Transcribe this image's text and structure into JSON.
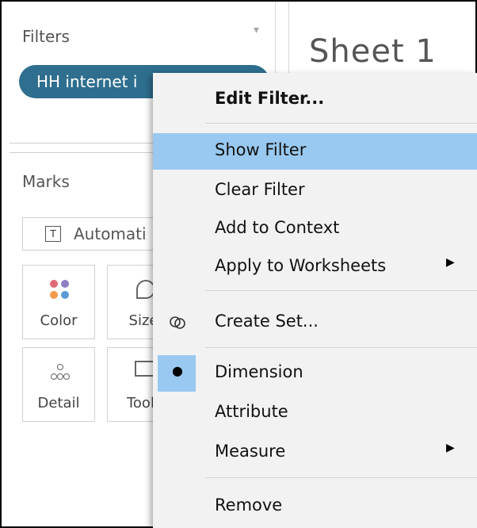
{
  "filters": {
    "title": "Filters",
    "pill_label": "HH internet i"
  },
  "marks": {
    "title": "Marks",
    "type_label": "Automati",
    "tiles": [
      {
        "label": "Color",
        "icon": "color-dots-icon"
      },
      {
        "label": "Size",
        "icon": "size-icon"
      },
      {
        "label": "Detail",
        "icon": "detail-dots-icon"
      },
      {
        "label": "Toolt",
        "icon": "tooltip-icon"
      }
    ]
  },
  "sheet": {
    "title": "Sheet 1"
  },
  "menu": {
    "edit_filter": "Edit Filter...",
    "show_filter": "Show Filter",
    "clear_filter": "Clear Filter",
    "add_to_context": "Add to Context",
    "apply_to_worksheets": "Apply to Worksheets",
    "create_set": "Create Set...",
    "dimension": "Dimension",
    "attribute": "Attribute",
    "measure": "Measure",
    "remove": "Remove",
    "arrow_glyph": "▶",
    "bullet_glyph": "●"
  },
  "colors": {
    "pill": "#2e6e8e",
    "highlight": "#99c9f0",
    "menu_bg": "#f2f2f2"
  }
}
